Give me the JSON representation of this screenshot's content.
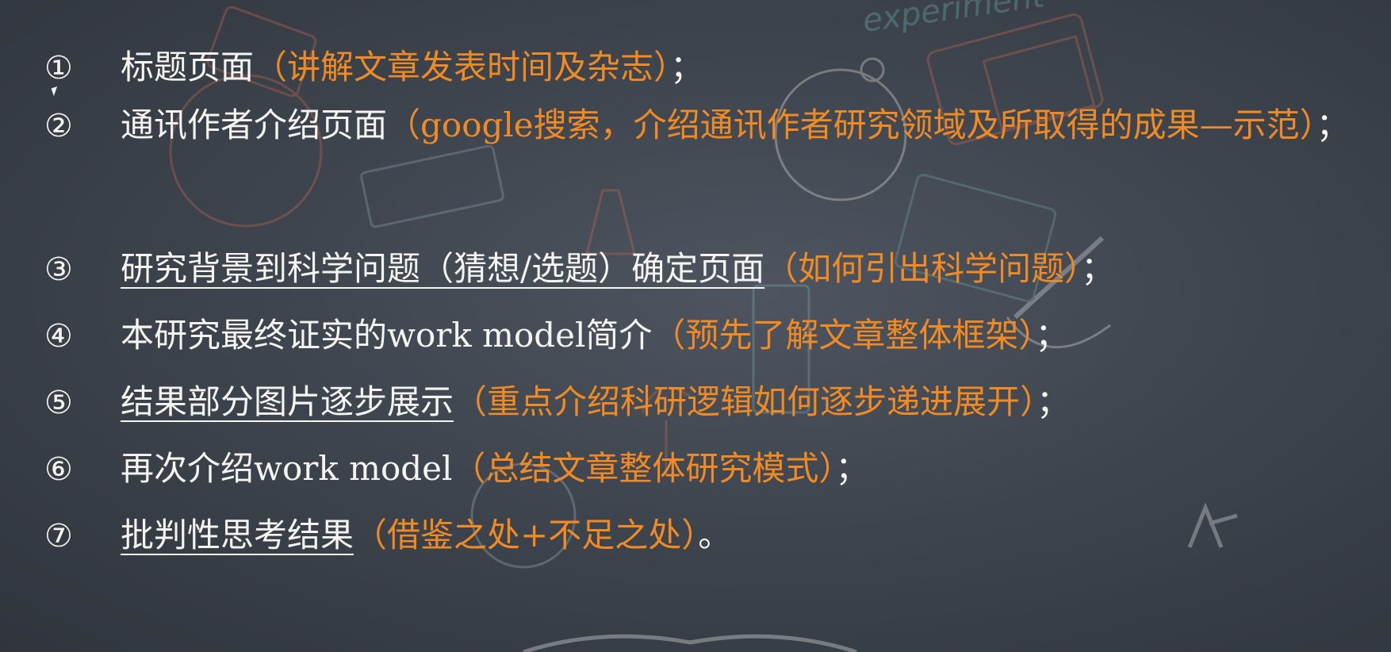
{
  "items": [
    {
      "num": "①",
      "main": "标题页面",
      "note": "（讲解文章发表时间及杂志）",
      "end": "；",
      "underline": false
    },
    {
      "num": "②",
      "main": "通讯作者介绍页面",
      "note": "（google搜索，介绍通讯作者研究领域及所取得的成果—示范）",
      "end": "；",
      "underline": false
    },
    {
      "num": "③",
      "main": "研究背景到科学问题（猜想/选题）确定页面",
      "note": "（如何引出科学问题）",
      "end": "；",
      "underline": true
    },
    {
      "num": "④",
      "main": "本研究最终证实的work model简介",
      "note": "（预先了解文章整体框架）",
      "end": "；",
      "underline": false
    },
    {
      "num": "⑤",
      "main": "结果部分图片逐步展示",
      "note": "（重点介绍科研逻辑如何逐步递进展开）",
      "end": "；",
      "underline": true
    },
    {
      "num": "⑥",
      "main": "再次介绍work model",
      "note": "（总结文章整体研究模式）",
      "end": "；",
      "underline": false
    },
    {
      "num": "⑦",
      "main": "批判性思考结果",
      "note": "（借鉴之处+不足之处）",
      "end": "。",
      "underline": true
    }
  ],
  "background_text": "experiment",
  "colors": {
    "text": "#f4f4f0",
    "note": "#f08a24",
    "board": "#3f454e"
  }
}
